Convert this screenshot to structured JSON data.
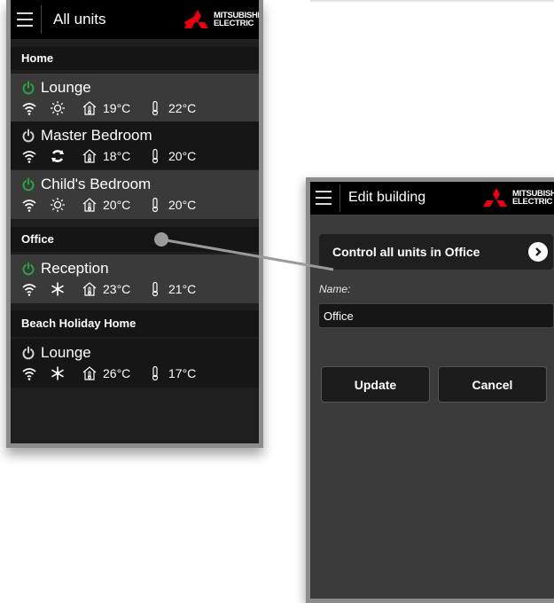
{
  "left_screen": {
    "title": "All units",
    "logo_line1": "MITSUBISHI",
    "logo_line2": "ELECTRIC",
    "buildings": [
      {
        "name": "Home",
        "units": [
          {
            "name": "Lounge",
            "power": "on",
            "mode": "sun-icon",
            "room_temp": "19°C",
            "set_temp": "22°C"
          },
          {
            "name": "Master Bedroom",
            "power": "off",
            "mode": "auto-cycle-icon",
            "room_temp": "18°C",
            "set_temp": "20°C"
          },
          {
            "name": "Child's Bedroom",
            "power": "on",
            "mode": "sun-icon",
            "room_temp": "20°C",
            "set_temp": "20°C"
          }
        ]
      },
      {
        "name": "Office",
        "units": [
          {
            "name": "Reception",
            "power": "on",
            "mode": "snowflake-icon",
            "room_temp": "23°C",
            "set_temp": "21°C"
          }
        ]
      },
      {
        "name": "Beach Holiday Home",
        "units": [
          {
            "name": "Lounge",
            "power": "off",
            "mode": "snowflake-icon",
            "room_temp": "26°C",
            "set_temp": "17°C"
          }
        ]
      }
    ]
  },
  "right_screen": {
    "title": "Edit building",
    "logo_line1": "MITSUBISHI",
    "logo_line2": "ELECTRIC",
    "control_all_label": "Control all units in Office",
    "name_label": "Name:",
    "name_value": "Office",
    "update_label": "Update",
    "cancel_label": "Cancel"
  },
  "colors": {
    "power_on": "#2ea043",
    "power_off": "#d0d0d0",
    "logo_red": "#e60012"
  }
}
